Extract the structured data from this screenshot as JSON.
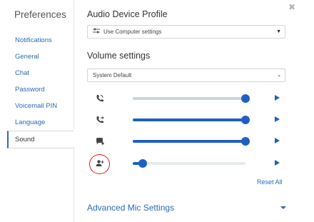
{
  "sidebar": {
    "title": "Preferences",
    "items": [
      {
        "label": "Notifications"
      },
      {
        "label": "General"
      },
      {
        "label": "Chat"
      },
      {
        "label": "Password"
      },
      {
        "label": "Voicemail PIN"
      },
      {
        "label": "Language"
      },
      {
        "label": "Sound",
        "active": true
      }
    ]
  },
  "audio_device": {
    "title": "Audio Device Profile",
    "selected": "Use Computer settings",
    "icon": "sliders-icon"
  },
  "volume": {
    "title": "Volume settings",
    "selected": "System Default",
    "sliders": [
      {
        "icon": "phone-ring-icon",
        "level": 1.0,
        "style": "light-fill"
      },
      {
        "icon": "phone-transfer-icon",
        "level": 1.0,
        "style": "filled"
      },
      {
        "icon": "chat-bubble-icon",
        "level": 1.0,
        "style": "filled"
      },
      {
        "icon": "person-add-icon",
        "level": 0.09,
        "style": "filled"
      }
    ],
    "reset_label": "Reset All"
  },
  "advanced": {
    "label": "Advanced Mic Settings"
  },
  "close_icon": "close-icon",
  "colors": {
    "accent": "#1f5fbf",
    "link": "#2a6bb5",
    "annotation": "#e01c1c"
  }
}
